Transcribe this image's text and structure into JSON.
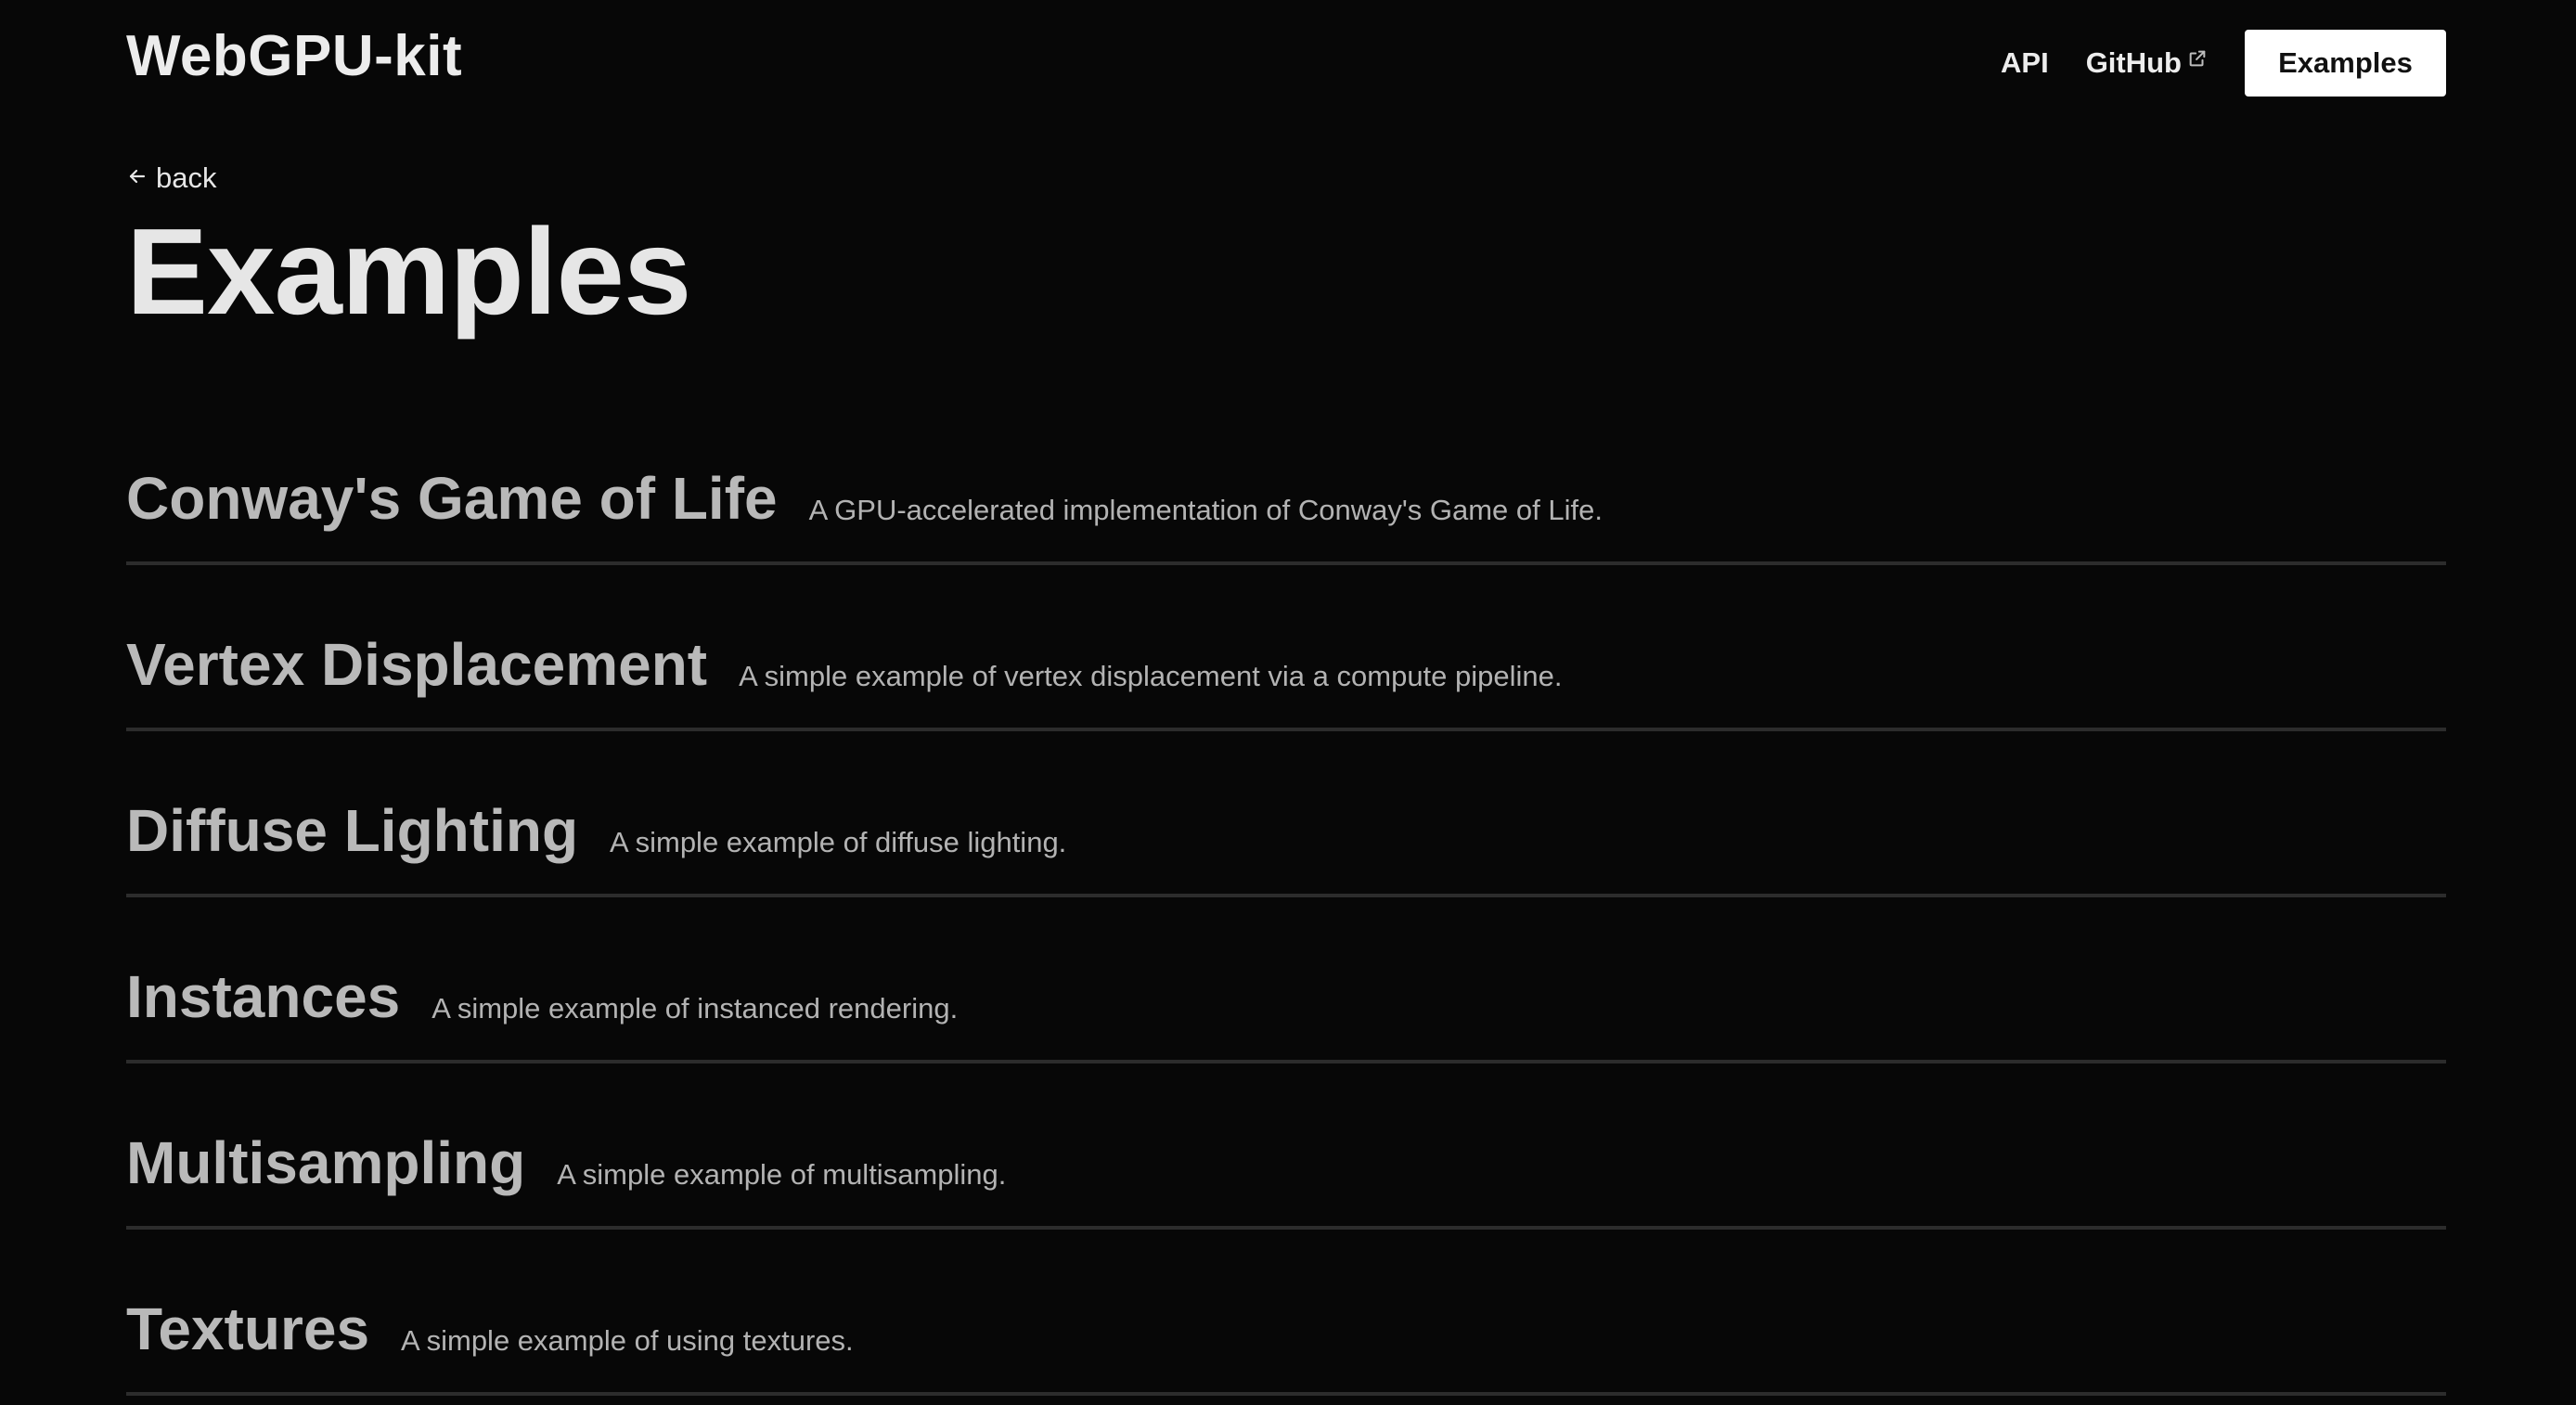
{
  "header": {
    "brand": "WebGPU-kit",
    "nav": {
      "api": "API",
      "github": "GitHub",
      "examples": "Examples"
    }
  },
  "page": {
    "back": "back",
    "title": "Examples"
  },
  "examples": [
    {
      "title": "Conway's Game of Life",
      "description": "A GPU-accelerated implementation of Conway's Game of Life."
    },
    {
      "title": "Vertex Displacement",
      "description": "A simple example of vertex displacement via a compute pipeline."
    },
    {
      "title": "Diffuse Lighting",
      "description": "A simple example of diffuse lighting."
    },
    {
      "title": "Instances",
      "description": "A simple example of instanced rendering."
    },
    {
      "title": "Multisampling",
      "description": "A simple example of multisampling."
    },
    {
      "title": "Textures",
      "description": "A simple example of using textures."
    }
  ],
  "icons": {
    "external": "external-link-icon",
    "back": "arrow-left-icon"
  },
  "colors": {
    "background": "#070707",
    "text": "#e6e6e6",
    "muted": "#b9b9b9",
    "divider": "#2c2c2c",
    "button_bg": "#ffffff",
    "button_text": "#111111"
  }
}
